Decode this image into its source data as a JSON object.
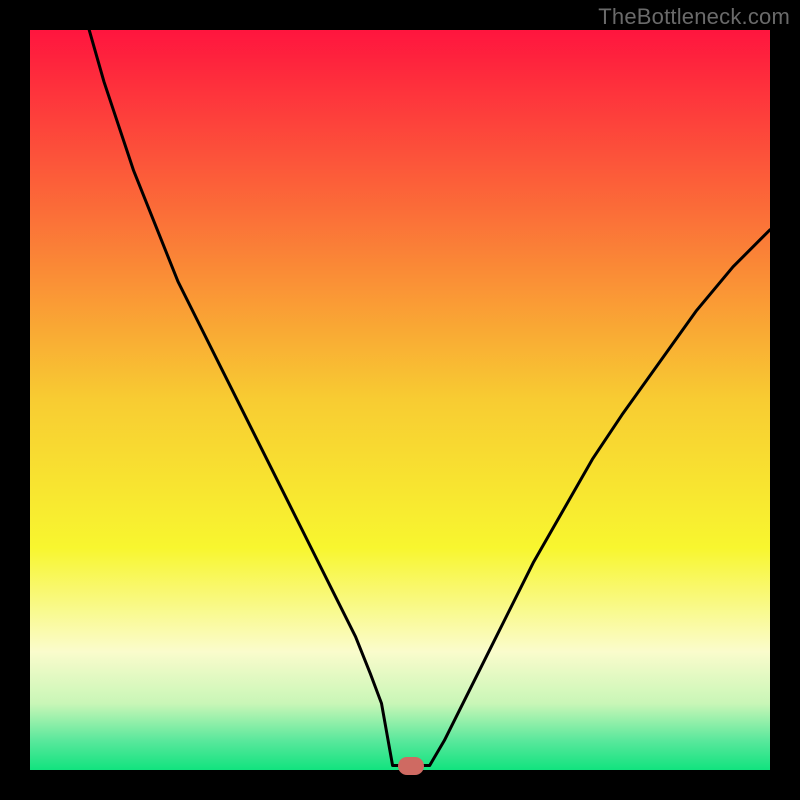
{
  "attribution": "TheBottleneck.com",
  "chart_data": {
    "type": "line",
    "title": "",
    "xlabel": "",
    "ylabel": "",
    "xlim": [
      0,
      100
    ],
    "ylim": [
      0,
      100
    ],
    "gradient_stops": [
      {
        "offset": 0,
        "color": "#ff153e"
      },
      {
        "offset": 25,
        "color": "#fb6f38"
      },
      {
        "offset": 50,
        "color": "#f8cc32"
      },
      {
        "offset": 70,
        "color": "#f8f62f"
      },
      {
        "offset": 84,
        "color": "#fafccc"
      },
      {
        "offset": 91,
        "color": "#c9f6b7"
      },
      {
        "offset": 96,
        "color": "#5ae89c"
      },
      {
        "offset": 100,
        "color": "#11e37f"
      }
    ],
    "series": [
      {
        "name": "bottleneck-curve",
        "x": [
          8,
          10,
          12,
          14,
          16,
          18,
          20,
          23,
          26,
          29,
          32,
          35,
          38,
          41,
          44,
          46,
          47.5,
          49,
          50,
          51,
          52,
          53,
          54,
          56,
          58,
          61,
          64,
          68,
          72,
          76,
          80,
          85,
          90,
          95,
          100
        ],
        "y": [
          100,
          93,
          87,
          81,
          76,
          71,
          66,
          60,
          54,
          48,
          42,
          36,
          30,
          24,
          18,
          13,
          9,
          5,
          2.5,
          1.2,
          0.6,
          0.6,
          1.2,
          4,
          8,
          14,
          20,
          28,
          35,
          42,
          48,
          55,
          62,
          68,
          73
        ]
      }
    ],
    "plateau": {
      "x_start": 49,
      "x_end": 54,
      "y": 0.6
    },
    "marker": {
      "x": 51.5,
      "y": 0.6,
      "color": "#cf6a62"
    }
  }
}
